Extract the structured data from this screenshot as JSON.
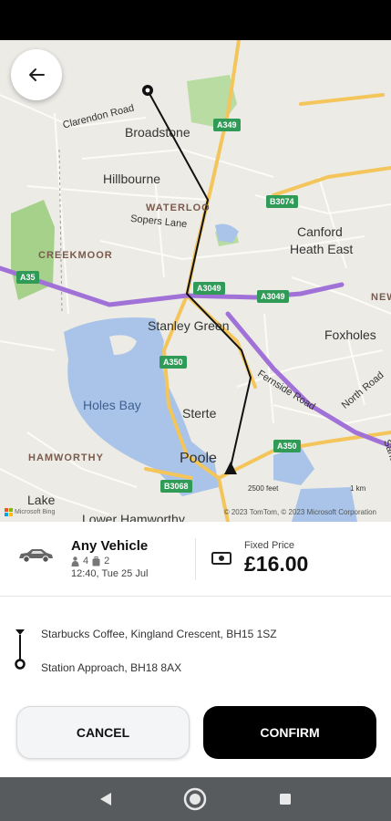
{
  "map": {
    "labels": {
      "broadstone": "Broadstone",
      "hillbourne": "Hillbourne",
      "waterloo": "WATERLOO",
      "sopers_lane": "Sopers Lane",
      "canford_heath_east_line1": "Canford",
      "canford_heath_east_line2": "Heath East",
      "creekmoor": "CREEKMOOR",
      "stanley_green": "Stanley Green",
      "foxholes": "Foxholes",
      "holes_bay": "Holes Bay",
      "sterte": "Sterte",
      "hamworthy": "HAMWORTHY",
      "poole": "Poole",
      "lake": "Lake",
      "lower_hamworthy": "Lower Hamworthy",
      "clarendon_road": "Clarendon Road",
      "fernside_road": "Fernside Road",
      "north_road": "North Road",
      "sandbanks_road": "Sandbanks Road",
      "new": "NEW"
    },
    "road_shields": {
      "a349": "A349",
      "b3074": "B3074",
      "a35": "A35",
      "a3049_left": "A3049",
      "a3049_right": "A3049",
      "a350_upper": "A350",
      "a350_lower": "A350",
      "b3068": "B3068"
    },
    "scale_feet": "2500 feet",
    "scale_km": "1 km",
    "copyright": "© 2023 TomTom, © 2023 Microsoft Corporation",
    "provider_logo": "Microsoft Bing"
  },
  "vehicle": {
    "name": "Any Vehicle",
    "passengers": "4",
    "luggage": "2",
    "datetime": "12:40, Tue 25 Jul"
  },
  "price": {
    "label": "Fixed Price",
    "value": "£16.00"
  },
  "route": {
    "pickup": "Starbucks Coffee, Kingland Crescent, BH15 1SZ",
    "dropoff": "Station Approach, BH18 8AX"
  },
  "actions": {
    "cancel": "CANCEL",
    "confirm": "CONFIRM"
  },
  "colors": {
    "primary_road": "#f3c55a",
    "a_road": "#a071d6",
    "water": "#a9c4e8",
    "park": "#a6d18a",
    "route": "#111111"
  }
}
